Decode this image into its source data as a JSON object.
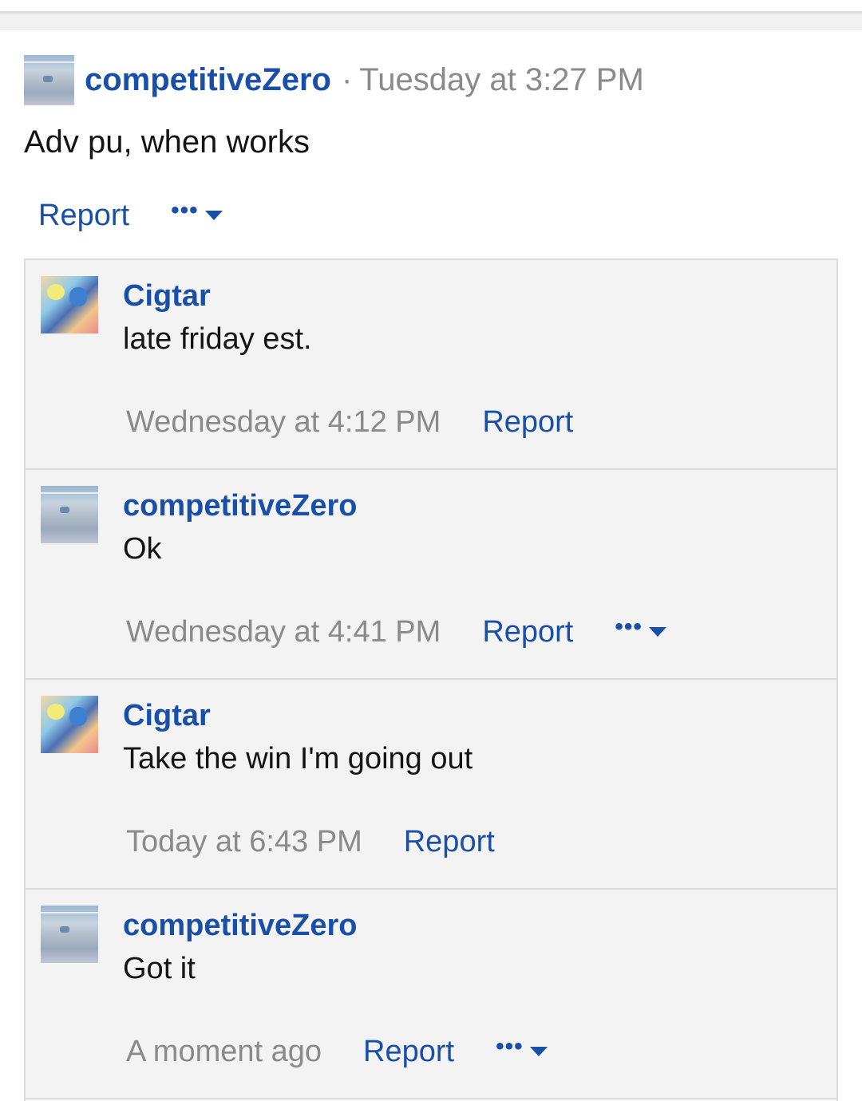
{
  "status": {
    "author": "competitiveZero",
    "separator": "·",
    "time": "Tuesday at 3:27 PM",
    "message": "Adv pu, when works",
    "report_label": "Report",
    "more_label": "•••"
  },
  "comments": [
    {
      "author": "Cigtar",
      "message": "late friday est.",
      "time": "Wednesday at 4:12 PM",
      "report_label": "Report",
      "avatar": "cigtar-avatar"
    },
    {
      "author": "competitiveZero",
      "message": "Ok",
      "time": "Wednesday at 4:41 PM",
      "report_label": "Report",
      "more_label": "•••",
      "avatar": "competitivezero-avatar"
    },
    {
      "author": "Cigtar",
      "message": "Take the win I'm going out",
      "time": "Today at 6:43 PM",
      "report_label": "Report",
      "avatar": "cigtar-avatar"
    },
    {
      "author": "competitiveZero",
      "message": "Got it",
      "time": "A moment ago",
      "report_label": "Report",
      "more_label": "•••",
      "avatar": "competitivezero-avatar"
    }
  ],
  "colors": {
    "link": "#1a4fa8",
    "muted": "#8a8a8a",
    "panel": "#f3f3f3",
    "border": "#dcdcdc"
  }
}
